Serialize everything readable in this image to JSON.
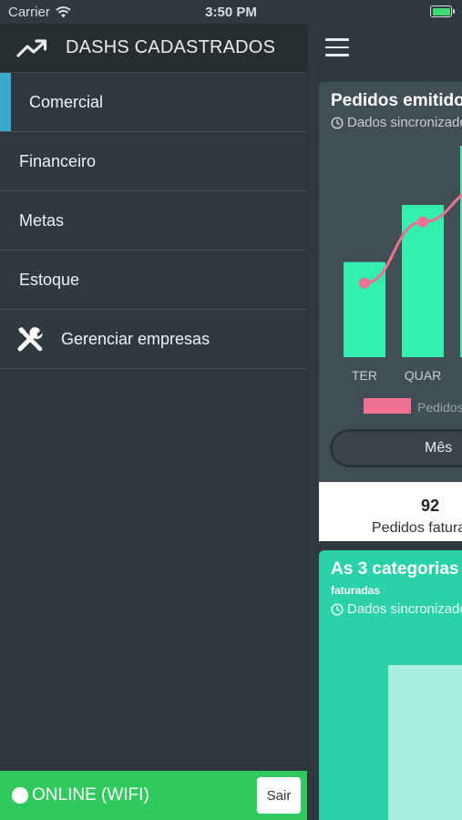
{
  "status_bar": {
    "carrier": "Carrier",
    "time": "3:50 PM"
  },
  "drawer": {
    "header_title": "DASHS CADASTRADOS",
    "items": [
      {
        "label": "Comercial",
        "active": true
      },
      {
        "label": "Financeiro"
      },
      {
        "label": "Metas"
      },
      {
        "label": "Estoque"
      },
      {
        "label": "Gerenciar empresas",
        "icon": "tools-icon"
      }
    ],
    "connection_status": "ONLINE (WIFI)",
    "logout_label": "Sair"
  },
  "main": {
    "card1": {
      "title": "Pedidos emitidos",
      "subtitle": "Dados sincronizados",
      "chart_data": {
        "type": "bar",
        "categories": [
          "TER",
          "QUAR",
          ""
        ],
        "series": [
          {
            "name": "Pedidos",
            "values": [
              0.45,
              0.72,
              1.0
            ]
          }
        ],
        "line_series_values": [
          0.35,
          0.64,
          0.8
        ],
        "colors": {
          "bars": "#34eeae",
          "line": "#f07191"
        }
      },
      "legend_label": "Pedidos",
      "period_label": "Mês"
    },
    "stat": {
      "value": "92",
      "label": "Pedidos faturados"
    },
    "card2": {
      "title": "As 3 categorias",
      "caption": "faturadas",
      "subtitle": "Dados sincronizados"
    }
  },
  "colors": {
    "drawer_bg": "#2e3a40",
    "accent": "#3ba9cf",
    "online": "#2fc95e",
    "bar": "#34eeae",
    "line": "#f07191",
    "card2": "#2ad1a9"
  }
}
